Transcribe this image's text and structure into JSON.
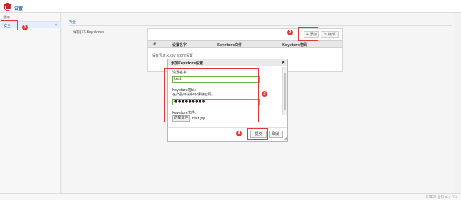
{
  "app": {
    "title": "设置"
  },
  "sidebar": {
    "section_label": "通用",
    "items": [
      {
        "label": "安全",
        "chevron": "»"
      }
    ]
  },
  "main": {
    "page_title": "安全",
    "keystore_label": "保存JKS Keystores",
    "toolbar": {
      "add_label": "+ 添加",
      "edit_label": "✎ 编辑"
    },
    "table": {
      "headers": [
        "#",
        "设置名字",
        "Keystore文件",
        "Keystore密码"
      ],
      "empty_text": "没有预定义key store设置"
    }
  },
  "dialog": {
    "title": "添加Keystore设置",
    "close_glyph": "✖",
    "name_label": "设置名字:",
    "name_value": "test",
    "password_label": "Keystore密码:",
    "password_hint": "在产品环境中不保存密码。",
    "password_value": "●●●●●●●●●",
    "file_label": "Keystore文件:",
    "file_button": "选择文件",
    "file_name": "test.jsp",
    "submit_label": "提交",
    "cancel_label": "取消"
  },
  "annotations": {
    "badges": [
      "1",
      "2",
      "3",
      "4"
    ],
    "color": "#e53935"
  },
  "footer": {
    "watermark": "CSDN @Crazy_Yu"
  }
}
